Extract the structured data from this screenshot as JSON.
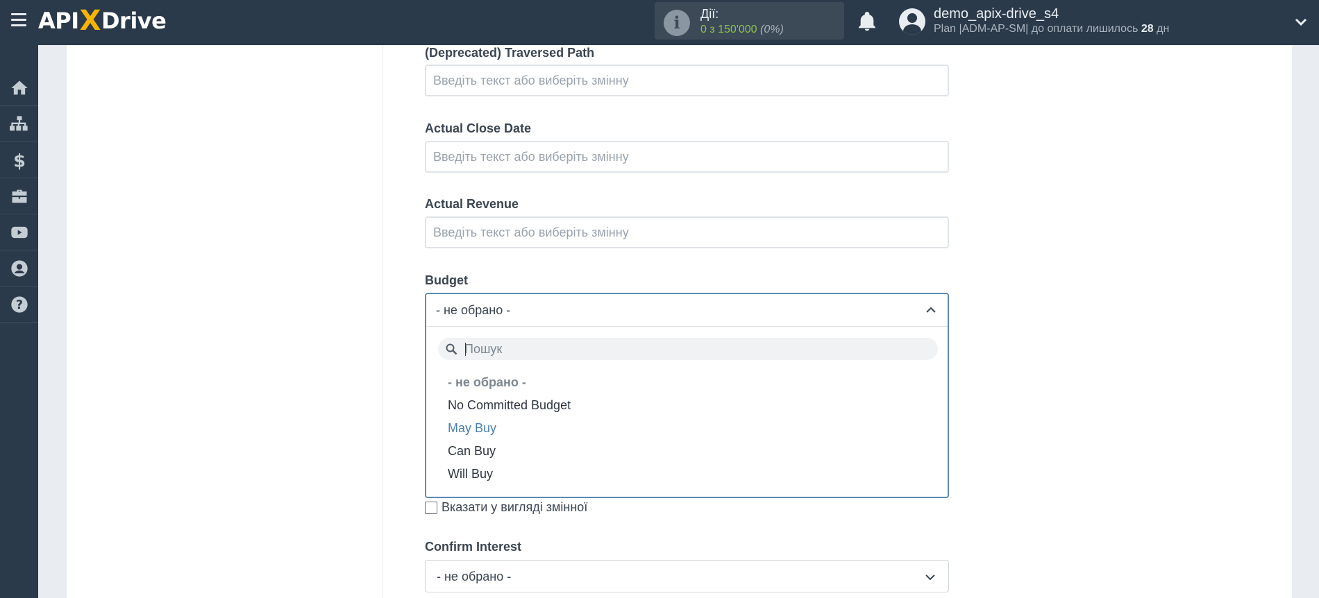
{
  "header": {
    "brand_left": "API",
    "brand_x": "X",
    "brand_right": "Drive",
    "actions_label": "Дії:",
    "actions_count": "0 з 150'000",
    "actions_percent": "(0%)",
    "user_name": "demo_apix-drive_s4",
    "plan_prefix": "Plan |ADM-AP-SM| до оплати лишилось",
    "plan_days": "28",
    "plan_suffix": "дн"
  },
  "sidebar": {
    "icons": [
      "home-icon",
      "sitemap-icon",
      "dollar-icon",
      "briefcase-icon",
      "youtube-icon",
      "user-circle-icon",
      "help-icon"
    ]
  },
  "form": {
    "fields": [
      {
        "label": "(Deprecated) Traversed Path",
        "placeholder": "Введіть текст або виберіть змінну"
      },
      {
        "label": "Actual Close Date",
        "placeholder": "Введіть текст або виберіть змінну"
      },
      {
        "label": "Actual Revenue",
        "placeholder": "Введіть текст або виберіть змінну"
      }
    ],
    "budget": {
      "label": "Budget",
      "selected": "- не обрано -",
      "search_placeholder": "Пошук",
      "options": [
        "- не обрано -",
        "No Committed Budget",
        "May Buy",
        "Can Buy",
        "Will Buy"
      ],
      "hovered_option": "May Buy"
    },
    "variable_checkbox_label": "Вказати у вигляді змінної",
    "confirm_interest": {
      "label": "Confirm Interest",
      "selected": "- не обрано -"
    }
  },
  "colors": {
    "topbar": "#2b3a4a",
    "accent_yellow": "#f7b500",
    "count_green": "#8bc34a",
    "focus_border": "#5a8bb3",
    "hover_option": "#4a7fb0"
  }
}
